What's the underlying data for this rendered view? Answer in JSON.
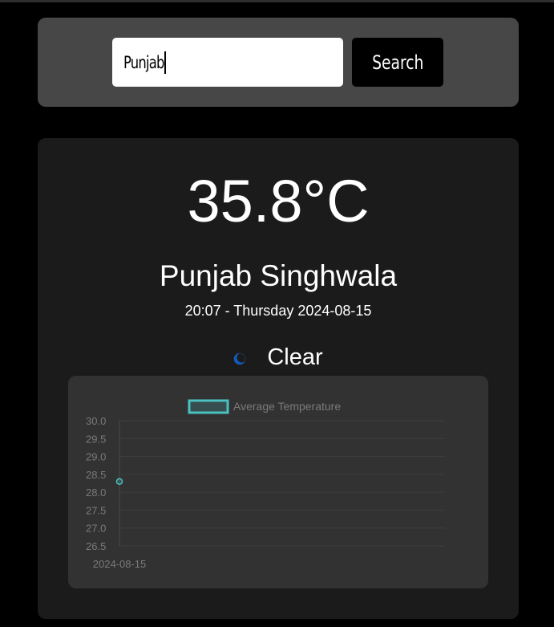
{
  "search": {
    "value": "Punjab",
    "button_label": "Search"
  },
  "weather": {
    "temperature": "35.8°C",
    "location": "Punjab Singhwala",
    "datetime": "20:07 - Thursday 2024-08-15",
    "condition": "Clear",
    "condition_icon": "moon-icon"
  },
  "colors": {
    "background": "#000000",
    "search_panel": "#474747",
    "weather_panel": "#1b1b1b",
    "chart_panel": "#323232",
    "series": "#4bc0c0"
  },
  "chart_data": {
    "type": "line",
    "x": [
      "2024-08-15"
    ],
    "series": [
      {
        "name": "Average Temperature",
        "values": [
          28.3
        ]
      }
    ],
    "ylim": [
      26.5,
      30.0
    ],
    "yticks": [
      "30.0",
      "29.5",
      "29.0",
      "28.5",
      "28.0",
      "27.5",
      "27.0",
      "26.5"
    ],
    "legend": "top",
    "grid": true
  }
}
